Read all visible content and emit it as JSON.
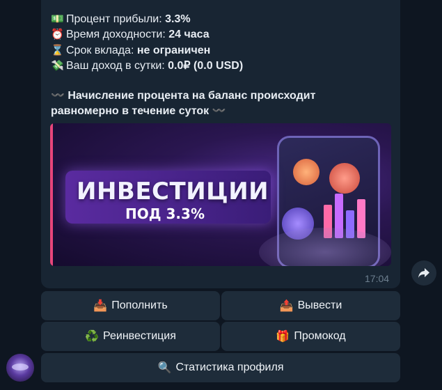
{
  "message": {
    "lines": [
      {
        "emoji": "💵",
        "label": "Процент прибыли: ",
        "value": "3.3%"
      },
      {
        "emoji": "⏰",
        "label": "Время доходности: ",
        "value": "24 часа"
      },
      {
        "emoji": "⌛",
        "label": "Срок вклада: ",
        "value": "не ограничен"
      },
      {
        "emoji": "💸",
        "label": "Ваш доход в сутки: ",
        "value": "0.0₽ (0.0 USD)"
      }
    ],
    "note_line1": "〰️ Начисление процента на баланс происходит",
    "note_line2": "равномерно в течение суток 〰️",
    "banner": {
      "title": "ИНВЕСТИЦИИ",
      "subtitle": "ПОД 3.3%"
    },
    "time": "17:04"
  },
  "buttons": [
    {
      "emoji": "📥",
      "label": "Пополнить"
    },
    {
      "emoji": "📤",
      "label": "Вывести"
    },
    {
      "emoji": "♻️",
      "label": "Реинвестиция"
    },
    {
      "emoji": "🎁",
      "label": "Промокод"
    },
    {
      "emoji": "🔍",
      "label": "Статистика профиля"
    }
  ],
  "icons": {
    "share": "share-arrow-icon",
    "avatar": "bot-avatar"
  },
  "colors": {
    "background": "#0e1621",
    "bubble": "#182533",
    "button": "#1e2c3a",
    "accent": "#e8457b"
  }
}
